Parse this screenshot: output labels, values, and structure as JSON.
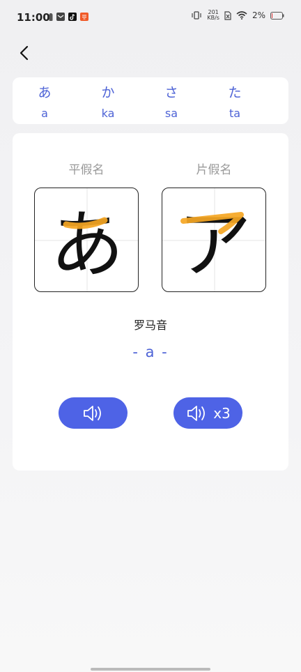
{
  "status_bar": {
    "time": "11:00",
    "net_speed_value": "201",
    "net_speed_unit": "KB/s",
    "battery": "2%",
    "icons": [
      "battery-icon",
      "mail-icon",
      "tiktok-icon",
      "app-icon",
      "vibrate-icon",
      "no-sim-icon",
      "wifi-icon"
    ]
  },
  "nav": {
    "back_icon": "chevron-left-icon"
  },
  "tabs": [
    {
      "kana": "あ",
      "romaji": "a"
    },
    {
      "kana": "か",
      "romaji": "ka"
    },
    {
      "kana": "さ",
      "romaji": "sa"
    },
    {
      "kana": "た",
      "romaji": "ta"
    }
  ],
  "card": {
    "hiragana_label": "平假名",
    "katakana_label": "片假名",
    "hiragana_char": "あ",
    "katakana_char": "ア",
    "romaji_label": "罗马音",
    "romaji_value": "- a -"
  },
  "buttons": {
    "play_icon": "speaker-icon",
    "repeat_label": "x3"
  },
  "colors": {
    "accent": "#4e63e6",
    "stroke_highlight": "#f5a623",
    "text_blue": "#4e63d6"
  }
}
